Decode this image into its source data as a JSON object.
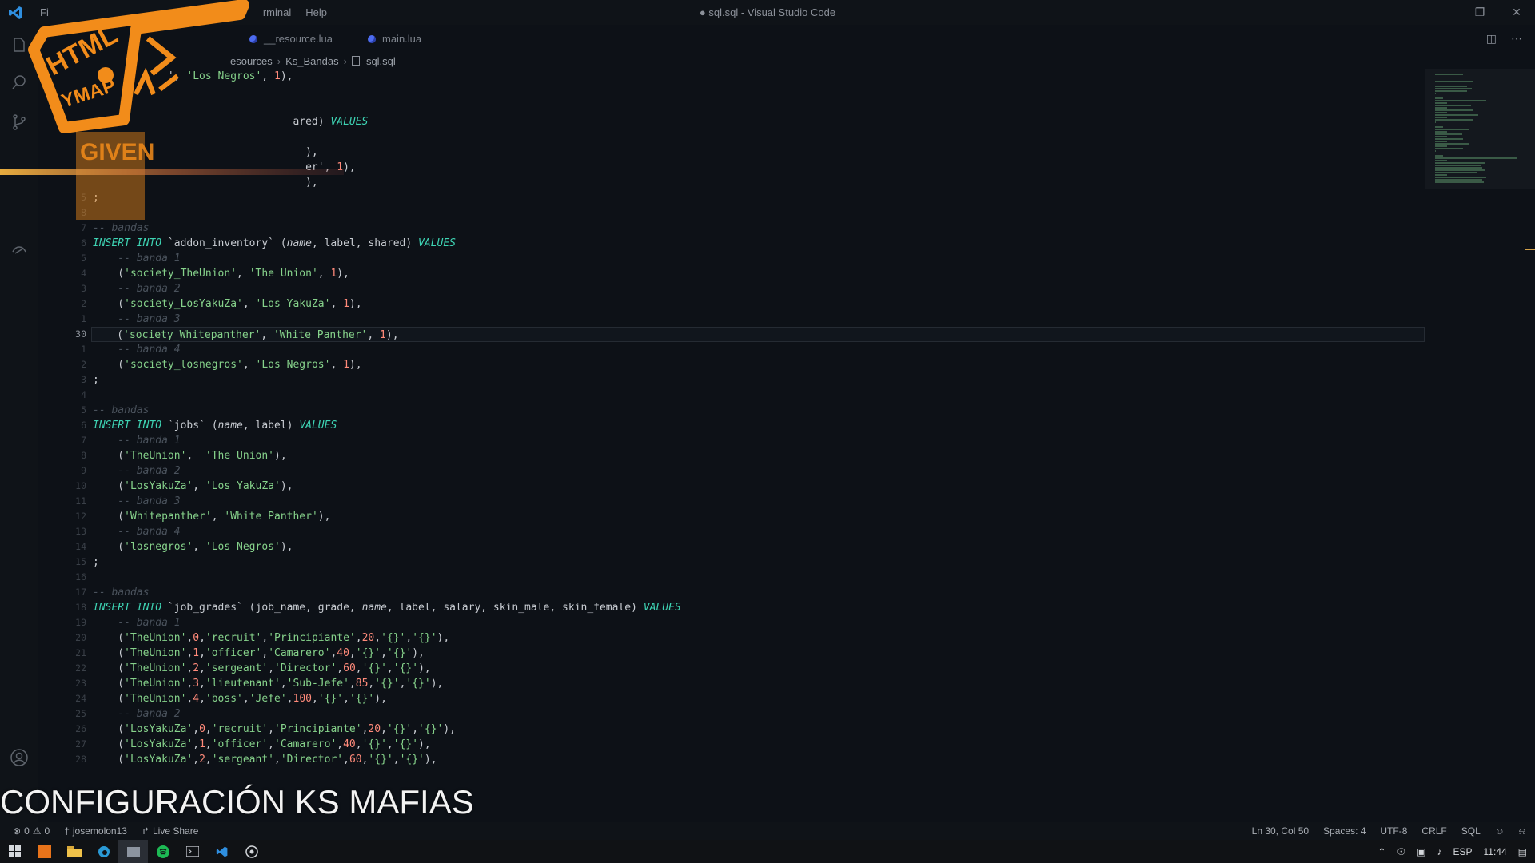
{
  "window": {
    "title": "● sql.sql - Visual Studio Code",
    "menu": [
      "Fi",
      "rminal",
      "Help"
    ]
  },
  "tabs": [
    {
      "label": "__resource.lua"
    },
    {
      "label": "main.lua"
    }
  ],
  "breadcrumb": [
    "esources",
    "Ks_Bandas",
    "sql.sql"
  ],
  "code_lines": [
    {
      "ln": "",
      "parts": [
        [
          "punc",
          "            ', "
        ],
        [
          "str",
          "'Los Negros'"
        ],
        [
          "punc",
          ", "
        ],
        [
          "num",
          "1"
        ],
        [
          "punc",
          "),"
        ]
      ]
    },
    {
      "ln": "",
      "parts": []
    },
    {
      "ln": "",
      "parts": []
    },
    {
      "ln": "",
      "parts": [
        [
          "punc",
          "                                ared) "
        ],
        [
          "kw",
          "VALUES"
        ]
      ]
    },
    {
      "ln": "",
      "parts": []
    },
    {
      "ln": "",
      "parts": [
        [
          "punc",
          "                                  ),"
        ]
      ]
    },
    {
      "ln": "",
      "parts": [
        [
          "punc",
          "                                  er', "
        ],
        [
          "num",
          "1"
        ],
        [
          "punc",
          "),"
        ]
      ]
    },
    {
      "ln": "",
      "parts": [
        [
          "punc",
          "                                  ),"
        ]
      ]
    },
    {
      "ln": "5",
      "parts": [
        [
          "punc",
          ";"
        ]
      ]
    },
    {
      "ln": "8",
      "parts": []
    },
    {
      "ln": "7",
      "parts": [
        [
          "cmt",
          "-- bandas"
        ]
      ]
    },
    {
      "ln": "6",
      "parts": [
        [
          "kw",
          "INSERT INTO "
        ],
        [
          "punc",
          "`addon_inventory` ("
        ],
        [
          "fn-it",
          "name"
        ],
        [
          "punc",
          ", label, shared) "
        ],
        [
          "kw",
          "VALUES"
        ]
      ]
    },
    {
      "ln": "5",
      "parts": [
        [
          "cmt",
          "    -- banda 1"
        ]
      ]
    },
    {
      "ln": "4",
      "parts": [
        [
          "punc",
          "    ("
        ],
        [
          "str",
          "'society_TheUnion'"
        ],
        [
          "punc",
          ", "
        ],
        [
          "str",
          "'The Union'"
        ],
        [
          "punc",
          ", "
        ],
        [
          "num",
          "1"
        ],
        [
          "punc",
          "),"
        ]
      ]
    },
    {
      "ln": "3",
      "parts": [
        [
          "cmt",
          "    -- banda 2"
        ]
      ]
    },
    {
      "ln": "2",
      "parts": [
        [
          "punc",
          "    ("
        ],
        [
          "str",
          "'society_LosYakuZa'"
        ],
        [
          "punc",
          ", "
        ],
        [
          "str",
          "'Los YakuZa'"
        ],
        [
          "punc",
          ", "
        ],
        [
          "num",
          "1"
        ],
        [
          "punc",
          "),"
        ]
      ]
    },
    {
      "ln": "1",
      "parts": [
        [
          "cmt",
          "    -- banda 3"
        ]
      ]
    },
    {
      "ln": "30",
      "current": true,
      "parts": [
        [
          "punc",
          "    ("
        ],
        [
          "str",
          "'society_Whitepanther'"
        ],
        [
          "punc",
          ", "
        ],
        [
          "str",
          "'White Panther'"
        ],
        [
          "punc",
          ", "
        ],
        [
          "num",
          "1"
        ],
        [
          "punc",
          "),"
        ]
      ]
    },
    {
      "ln": "1",
      "parts": [
        [
          "cmt",
          "    -- banda 4"
        ]
      ]
    },
    {
      "ln": "2",
      "parts": [
        [
          "punc",
          "    ("
        ],
        [
          "str",
          "'society_losnegros'"
        ],
        [
          "punc",
          ", "
        ],
        [
          "str",
          "'Los Negros'"
        ],
        [
          "punc",
          ", "
        ],
        [
          "num",
          "1"
        ],
        [
          "punc",
          "),"
        ]
      ]
    },
    {
      "ln": "3",
      "parts": [
        [
          "punc",
          ";"
        ]
      ]
    },
    {
      "ln": "4",
      "parts": []
    },
    {
      "ln": "5",
      "parts": [
        [
          "cmt",
          "-- bandas"
        ]
      ]
    },
    {
      "ln": "6",
      "parts": [
        [
          "kw",
          "INSERT INTO "
        ],
        [
          "punc",
          "`jobs` ("
        ],
        [
          "fn-it",
          "name"
        ],
        [
          "punc",
          ", label) "
        ],
        [
          "kw",
          "VALUES"
        ]
      ]
    },
    {
      "ln": "7",
      "parts": [
        [
          "cmt",
          "    -- banda 1"
        ]
      ]
    },
    {
      "ln": "8",
      "parts": [
        [
          "punc",
          "    ("
        ],
        [
          "str",
          "'TheUnion'"
        ],
        [
          "punc",
          ",  "
        ],
        [
          "str",
          "'The Union'"
        ],
        [
          "punc",
          "),"
        ]
      ]
    },
    {
      "ln": "9",
      "parts": [
        [
          "cmt",
          "    -- banda 2"
        ]
      ]
    },
    {
      "ln": "10",
      "parts": [
        [
          "punc",
          "    ("
        ],
        [
          "str",
          "'LosYakuZa'"
        ],
        [
          "punc",
          ", "
        ],
        [
          "str",
          "'Los YakuZa'"
        ],
        [
          "punc",
          "),"
        ]
      ]
    },
    {
      "ln": "11",
      "parts": [
        [
          "cmt",
          "    -- banda 3"
        ]
      ]
    },
    {
      "ln": "12",
      "parts": [
        [
          "punc",
          "    ("
        ],
        [
          "str",
          "'Whitepanther'"
        ],
        [
          "punc",
          ", "
        ],
        [
          "str",
          "'White Panther'"
        ],
        [
          "punc",
          "),"
        ]
      ]
    },
    {
      "ln": "13",
      "parts": [
        [
          "cmt",
          "    -- banda 4"
        ]
      ]
    },
    {
      "ln": "14",
      "parts": [
        [
          "punc",
          "    ("
        ],
        [
          "str",
          "'losnegros'"
        ],
        [
          "punc",
          ", "
        ],
        [
          "str",
          "'Los Negros'"
        ],
        [
          "punc",
          "),"
        ]
      ]
    },
    {
      "ln": "15",
      "parts": [
        [
          "punc",
          ";"
        ]
      ]
    },
    {
      "ln": "16",
      "parts": []
    },
    {
      "ln": "17",
      "parts": [
        [
          "cmt",
          "-- bandas"
        ]
      ]
    },
    {
      "ln": "18",
      "parts": [
        [
          "kw",
          "INSERT INTO "
        ],
        [
          "punc",
          "`job_grades` (job_name, grade, "
        ],
        [
          "fn-it",
          "name"
        ],
        [
          "punc",
          ", label, salary, skin_male, skin_female) "
        ],
        [
          "kw",
          "VALUES"
        ]
      ]
    },
    {
      "ln": "19",
      "parts": [
        [
          "cmt",
          "    -- banda 1"
        ]
      ]
    },
    {
      "ln": "20",
      "parts": [
        [
          "punc",
          "    ("
        ],
        [
          "str",
          "'TheUnion'"
        ],
        [
          "punc",
          ","
        ],
        [
          "num",
          "0"
        ],
        [
          "punc",
          ","
        ],
        [
          "str",
          "'recruit'"
        ],
        [
          "punc",
          ","
        ],
        [
          "str",
          "'Principiante'"
        ],
        [
          "punc",
          ","
        ],
        [
          "num",
          "20"
        ],
        [
          "punc",
          ","
        ],
        [
          "str",
          "'{}'"
        ],
        [
          "punc",
          ","
        ],
        [
          "str",
          "'{}'"
        ],
        [
          "punc",
          "),"
        ]
      ]
    },
    {
      "ln": "21",
      "parts": [
        [
          "punc",
          "    ("
        ],
        [
          "str",
          "'TheUnion'"
        ],
        [
          "punc",
          ","
        ],
        [
          "num",
          "1"
        ],
        [
          "punc",
          ","
        ],
        [
          "str",
          "'officer'"
        ],
        [
          "punc",
          ","
        ],
        [
          "str",
          "'Camarero'"
        ],
        [
          "punc",
          ","
        ],
        [
          "num",
          "40"
        ],
        [
          "punc",
          ","
        ],
        [
          "str",
          "'{}'"
        ],
        [
          "punc",
          ","
        ],
        [
          "str",
          "'{}'"
        ],
        [
          "punc",
          "),"
        ]
      ]
    },
    {
      "ln": "22",
      "parts": [
        [
          "punc",
          "    ("
        ],
        [
          "str",
          "'TheUnion'"
        ],
        [
          "punc",
          ","
        ],
        [
          "num",
          "2"
        ],
        [
          "punc",
          ","
        ],
        [
          "str",
          "'sergeant'"
        ],
        [
          "punc",
          ","
        ],
        [
          "str",
          "'Director'"
        ],
        [
          "punc",
          ","
        ],
        [
          "num",
          "60"
        ],
        [
          "punc",
          ","
        ],
        [
          "str",
          "'{}'"
        ],
        [
          "punc",
          ","
        ],
        [
          "str",
          "'{}'"
        ],
        [
          "punc",
          "),"
        ]
      ]
    },
    {
      "ln": "23",
      "parts": [
        [
          "punc",
          "    ("
        ],
        [
          "str",
          "'TheUnion'"
        ],
        [
          "punc",
          ","
        ],
        [
          "num",
          "3"
        ],
        [
          "punc",
          ","
        ],
        [
          "str",
          "'lieutenant'"
        ],
        [
          "punc",
          ","
        ],
        [
          "str",
          "'Sub-Jefe'"
        ],
        [
          "punc",
          ","
        ],
        [
          "num",
          "85"
        ],
        [
          "punc",
          ","
        ],
        [
          "str",
          "'{}'"
        ],
        [
          "punc",
          ","
        ],
        [
          "str",
          "'{}'"
        ],
        [
          "punc",
          "),"
        ]
      ]
    },
    {
      "ln": "24",
      "parts": [
        [
          "punc",
          "    ("
        ],
        [
          "str",
          "'TheUnion'"
        ],
        [
          "punc",
          ","
        ],
        [
          "num",
          "4"
        ],
        [
          "punc",
          ","
        ],
        [
          "str",
          "'boss'"
        ],
        [
          "punc",
          ","
        ],
        [
          "str",
          "'Jefe'"
        ],
        [
          "punc",
          ","
        ],
        [
          "num",
          "100"
        ],
        [
          "punc",
          ","
        ],
        [
          "str",
          "'{}'"
        ],
        [
          "punc",
          ","
        ],
        [
          "str",
          "'{}'"
        ],
        [
          "punc",
          "),"
        ]
      ]
    },
    {
      "ln": "25",
      "parts": [
        [
          "cmt",
          "    -- banda 2"
        ]
      ]
    },
    {
      "ln": "26",
      "parts": [
        [
          "punc",
          "    ("
        ],
        [
          "str",
          "'LosYakuZa'"
        ],
        [
          "punc",
          ","
        ],
        [
          "num",
          "0"
        ],
        [
          "punc",
          ","
        ],
        [
          "str",
          "'recruit'"
        ],
        [
          "punc",
          ","
        ],
        [
          "str",
          "'Principiante'"
        ],
        [
          "punc",
          ","
        ],
        [
          "num",
          "20"
        ],
        [
          "punc",
          ","
        ],
        [
          "str",
          "'{}'"
        ],
        [
          "punc",
          ","
        ],
        [
          "str",
          "'{}'"
        ],
        [
          "punc",
          "),"
        ]
      ]
    },
    {
      "ln": "27",
      "parts": [
        [
          "punc",
          "    ("
        ],
        [
          "str",
          "'LosYakuZa'"
        ],
        [
          "punc",
          ","
        ],
        [
          "num",
          "1"
        ],
        [
          "punc",
          ","
        ],
        [
          "str",
          "'officer'"
        ],
        [
          "punc",
          ","
        ],
        [
          "str",
          "'Camarero'"
        ],
        [
          "punc",
          ","
        ],
        [
          "num",
          "40"
        ],
        [
          "punc",
          ","
        ],
        [
          "str",
          "'{}'"
        ],
        [
          "punc",
          ","
        ],
        [
          "str",
          "'{}'"
        ],
        [
          "punc",
          "),"
        ]
      ]
    },
    {
      "ln": "28",
      "parts": [
        [
          "punc",
          "    ("
        ],
        [
          "str",
          "'LosYakuZa'"
        ],
        [
          "punc",
          ","
        ],
        [
          "num",
          "2"
        ],
        [
          "punc",
          ","
        ],
        [
          "str",
          "'sergeant'"
        ],
        [
          "punc",
          ","
        ],
        [
          "str",
          "'Director'"
        ],
        [
          "punc",
          ","
        ],
        [
          "num",
          "60"
        ],
        [
          "punc",
          ","
        ],
        [
          "str",
          "'{}'"
        ],
        [
          "punc",
          ","
        ],
        [
          "str",
          "'{}'"
        ],
        [
          "punc",
          "),"
        ]
      ]
    }
  ],
  "caption": "CONFIGURACIÓN KS MAFIAS",
  "logo_text": [
    "HTML",
    "YMAP",
    "GIVEN"
  ],
  "status": {
    "errors": "0",
    "warnings": "0",
    "user": "josemolon13",
    "live_share": "Live Share",
    "position": "Ln 30, Col 50",
    "spaces": "Spaces: 4",
    "encoding": "UTF-8",
    "eol": "CRLF",
    "language": "SQL"
  },
  "taskbar": {
    "lang": "ESP",
    "time": "11:44"
  },
  "colors": {
    "accent": "#f28c1a",
    "keyword": "#3ed4b4",
    "string": "#86d28b",
    "number": "#ff8a7a"
  }
}
